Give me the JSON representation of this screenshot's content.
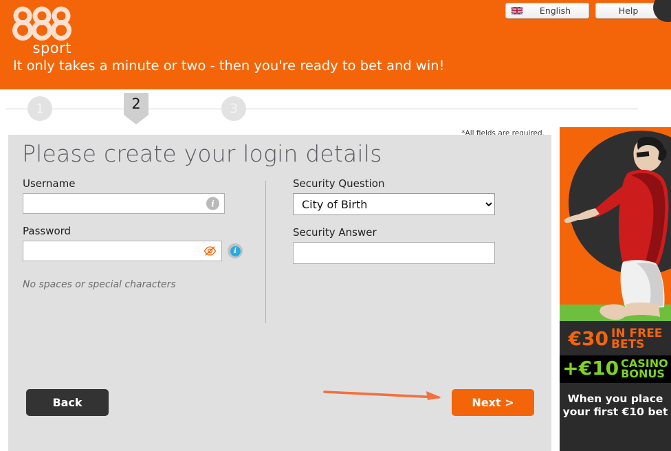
{
  "header": {
    "logo_text": "888",
    "logo_sub": "sport",
    "tagline": "It only takes a minute or two - then you're ready to bet and win!",
    "language_label": "English",
    "language_icon": "uk-flag-icon",
    "help_label": "Help"
  },
  "steps": {
    "items": [
      {
        "label": "1",
        "active": false
      },
      {
        "label": "2",
        "active": true
      },
      {
        "label": "3",
        "active": false
      }
    ]
  },
  "form": {
    "required_note": "*All fields are required.",
    "title": "Please create your login details",
    "username": {
      "label": "Username",
      "value": "",
      "placeholder": "",
      "info_icon": "info-icon"
    },
    "password": {
      "label": "Password",
      "value": "",
      "placeholder": "",
      "toggle_icon": "eye-slash-icon",
      "info_icon": "info-icon"
    },
    "hint": "No spaces or special characters",
    "security_question": {
      "label": "Security Question",
      "selected": "City of Birth",
      "options": [
        "City of Birth"
      ]
    },
    "security_answer": {
      "label": "Security Answer",
      "value": "",
      "placeholder": ""
    },
    "back_label": "Back",
    "next_label": "Next >"
  },
  "promo": {
    "amount_1": "€30",
    "amount_1_line1": "IN FREE",
    "amount_1_line2": "BETS",
    "amount_2": "+€10",
    "amount_2_line1": "CASINO",
    "amount_2_line2": "BONUS",
    "condition": "When you place your first €10 bet"
  },
  "colors": {
    "brand_orange": "#f4650a",
    "panel_gray": "#e0e0e0",
    "dark_button": "#333333",
    "promo_green": "#7ed321",
    "info_blue": "#29abe2",
    "annotation_arrow": "#f4703c"
  }
}
